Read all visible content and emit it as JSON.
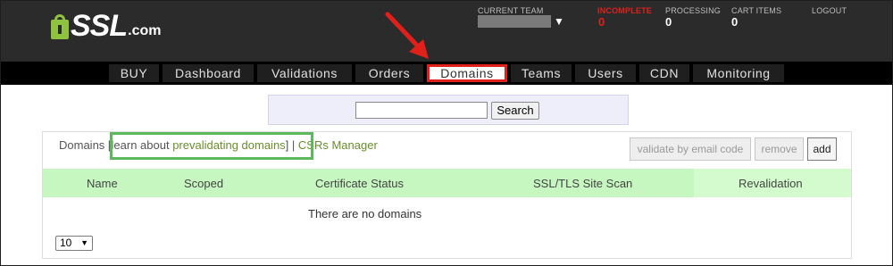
{
  "brand": {
    "name": "SSL",
    "suffix": ".com"
  },
  "header": {
    "current_team_label": "CURRENT TEAM",
    "incomplete_label": "INCOMPLETE",
    "incomplete_count": "0",
    "processing_label": "PROCESSING",
    "processing_count": "0",
    "cart_label": "CART ITEMS",
    "cart_count": "0",
    "logout_label": "LOGOUT"
  },
  "nav": {
    "items": [
      {
        "label": "BUY"
      },
      {
        "label": "Dashboard"
      },
      {
        "label": "Validations"
      },
      {
        "label": "Orders"
      },
      {
        "label": "Domains",
        "active": true
      },
      {
        "label": "Teams"
      },
      {
        "label": "Users"
      },
      {
        "label": "CDN"
      },
      {
        "label": "Monitoring"
      }
    ]
  },
  "search": {
    "value": "",
    "button_label": "Search"
  },
  "breadcrumb": {
    "domains": "Domains",
    "learn_open": "[learn about ",
    "learn_link": "prevalidating domains",
    "learn_close": "]",
    "separator": " | ",
    "csrs_link": "CSRs Manager"
  },
  "actions": {
    "validate": "validate by email code",
    "remove": "remove",
    "add": "add"
  },
  "table": {
    "columns": [
      "Name",
      "Scoped",
      "Certificate Status",
      "SSL/TLS Site Scan",
      "Revalidation"
    ],
    "empty_message": "There are no domains"
  },
  "pagination": {
    "page_size": "10"
  },
  "colors": {
    "brand_green": "#8fc23e",
    "incomplete_red": "#e0201b",
    "highlight_green": "#5bb95b",
    "table_header": "#c7f7c0"
  },
  "icons": {
    "caret": "chevron-down-icon",
    "annotation": "red-arrow-icon"
  }
}
